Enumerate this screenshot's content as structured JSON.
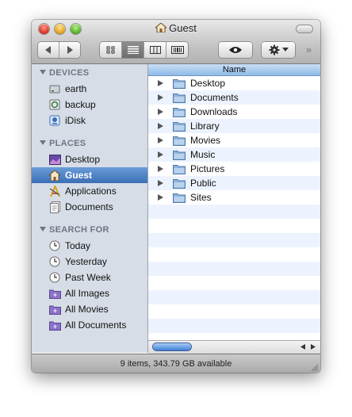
{
  "window": {
    "title": "Guest"
  },
  "toolbar": {
    "view_modes": [
      "icon",
      "list",
      "column",
      "cover-flow"
    ],
    "active_view": "list"
  },
  "sidebar": {
    "sections": [
      {
        "heading": "DEVICES",
        "items": [
          {
            "label": "earth",
            "icon": "hard-disk-icon"
          },
          {
            "label": "backup",
            "icon": "hard-disk-icon"
          },
          {
            "label": "iDisk",
            "icon": "idisk-icon"
          }
        ]
      },
      {
        "heading": "PLACES",
        "items": [
          {
            "label": "Desktop",
            "icon": "desktop-icon"
          },
          {
            "label": "Guest",
            "icon": "home-icon",
            "selected": true
          },
          {
            "label": "Applications",
            "icon": "applications-icon"
          },
          {
            "label": "Documents",
            "icon": "documents-icon"
          }
        ]
      },
      {
        "heading": "SEARCH FOR",
        "items": [
          {
            "label": "Today",
            "icon": "clock-icon"
          },
          {
            "label": "Yesterday",
            "icon": "clock-icon"
          },
          {
            "label": "Past Week",
            "icon": "clock-icon"
          },
          {
            "label": "All Images",
            "icon": "smart-folder-icon"
          },
          {
            "label": "All Movies",
            "icon": "smart-folder-icon"
          },
          {
            "label": "All Documents",
            "icon": "smart-folder-icon"
          }
        ]
      }
    ]
  },
  "list": {
    "column_header": "Name",
    "rows": [
      {
        "name": "Desktop",
        "icon": "folder-icon"
      },
      {
        "name": "Documents",
        "icon": "folder-icon"
      },
      {
        "name": "Downloads",
        "icon": "folder-icon"
      },
      {
        "name": "Library",
        "icon": "folder-icon"
      },
      {
        "name": "Movies",
        "icon": "folder-icon"
      },
      {
        "name": "Music",
        "icon": "folder-icon"
      },
      {
        "name": "Pictures",
        "icon": "folder-icon"
      },
      {
        "name": "Public",
        "icon": "folder-icon"
      },
      {
        "name": "Sites",
        "icon": "folder-icon"
      }
    ]
  },
  "status": {
    "text": "9 items, 343.79 GB available"
  },
  "colors": {
    "selection": "#3b6fb6",
    "sidebar_bg": "#d6dde6",
    "stripe": "#edf3fe",
    "folder": "#8fb4dc"
  }
}
